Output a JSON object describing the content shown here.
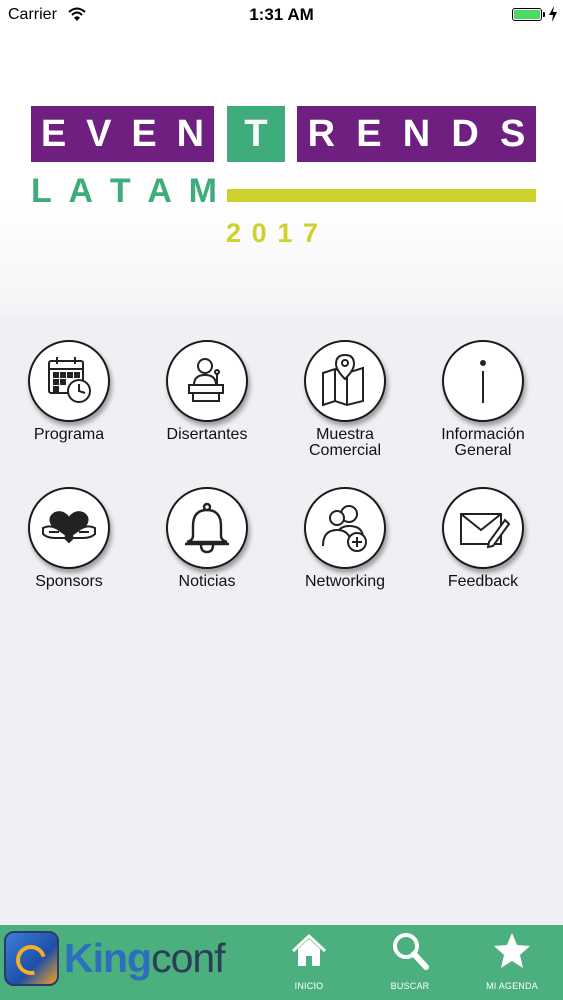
{
  "status_bar": {
    "carrier": "Carrier",
    "time": "1:31 AM"
  },
  "banner": {
    "logo_line1": [
      "EVEN",
      "T",
      "RENDS"
    ],
    "logo_line2": "LATAM",
    "logo_year": "2017",
    "colors": {
      "purple": "#6e1f80",
      "green": "#3ead7b",
      "lime": "#ccd12b"
    }
  },
  "menu": {
    "items": [
      {
        "label": "Programa",
        "icon": "calendar-clock-icon"
      },
      {
        "label": "Disertantes",
        "icon": "speaker-podium-icon"
      },
      {
        "label": "Muestra\nComercial",
        "icon": "map-pin-icon"
      },
      {
        "label": "Información\nGeneral",
        "icon": "info-icon"
      },
      {
        "label": "Sponsors",
        "icon": "heart-hands-icon"
      },
      {
        "label": "Noticias",
        "icon": "bell-icon"
      },
      {
        "label": "Networking",
        "icon": "add-people-icon"
      },
      {
        "label": "Feedback",
        "icon": "envelope-pen-icon"
      }
    ]
  },
  "tab_bar": {
    "brand_king": "King",
    "brand_conf": "conf",
    "tabs": [
      {
        "label": "INICIO",
        "icon": "home-icon"
      },
      {
        "label": "BUSCAR",
        "icon": "search-icon"
      },
      {
        "label": "MI AGENDA",
        "icon": "star-icon"
      }
    ],
    "color": "#4caf7e"
  }
}
